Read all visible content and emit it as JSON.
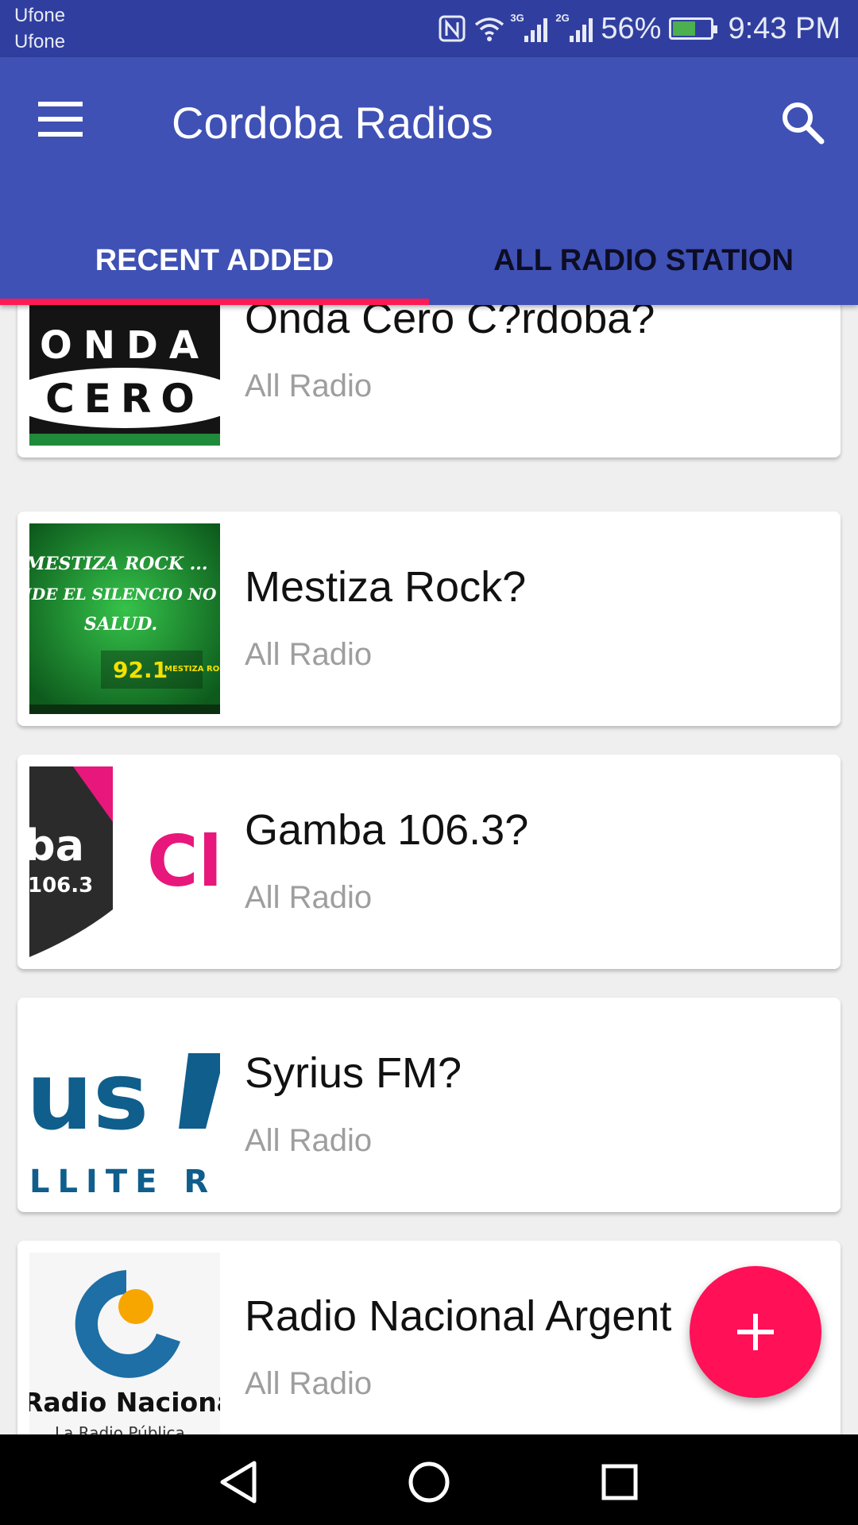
{
  "status": {
    "carrier1": "Ufone",
    "carrier2": "Ufone",
    "net1": "3G",
    "net2": "2G",
    "battery": "56%",
    "time": "9:43 PM"
  },
  "appbar": {
    "title": "Cordoba Radios",
    "menu_icon": "hamburger-menu-icon",
    "search_icon": "search-icon"
  },
  "tabs": [
    {
      "label": "RECENT ADDED",
      "active": true
    },
    {
      "label": "ALL RADIO STATION",
      "active": false
    }
  ],
  "stations": [
    {
      "title": "Onda Cero C?rdoba?",
      "subtitle": "All Radio"
    },
    {
      "title": "Mestiza Rock?",
      "subtitle": "All Radio"
    },
    {
      "title": "Gamba 106.3?",
      "subtitle": "All Radio"
    },
    {
      "title": "Syrius FM?",
      "subtitle": "All Radio"
    },
    {
      "title": "Radio Nacional Argent",
      "subtitle": "All Radio"
    }
  ],
  "logos": {
    "onda": [
      "ONDA",
      "CERO"
    ],
    "mestiza": [
      "MESTIZA ROCK ...",
      "NDE EL SILENCIO NO",
      "SALUD.",
      "92.1",
      "MESTIZA ROCK.COM.AR"
    ],
    "gamba": [
      "ba",
      "106.3",
      "Cl"
    ],
    "syrius": [
      "us",
      "LLITE R"
    ],
    "nacional": [
      "Radio Naciona",
      "La Radio Pública"
    ]
  },
  "fab": {
    "icon": "plus-icon"
  },
  "colors": {
    "primary": "#3f51b5",
    "primary_dark": "#303f9f",
    "accent": "#ff1057"
  }
}
